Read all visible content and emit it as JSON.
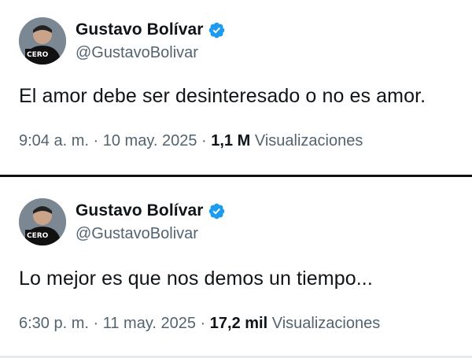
{
  "tweets": [
    {
      "author": {
        "name": "Gustavo Bolívar",
        "handle": "@GustavoBolivar",
        "avatar_badge": "CERO"
      },
      "text": "El amor debe ser desinteresado o no es amor.",
      "time": "9:04 a. m.",
      "separator": "·",
      "date": "10 may. 2025",
      "views_count": "1,1 M",
      "views_label": "Visualizaciones"
    },
    {
      "author": {
        "name": "Gustavo Bolívar",
        "handle": "@GustavoBolivar",
        "avatar_badge": "CERO"
      },
      "text": "Lo mejor es que nos demos un tiempo...",
      "time": "6:30 p. m.",
      "separator": "·",
      "date": "11 may. 2025",
      "views_count": "17,2 mil",
      "views_label": "Visualizaciones"
    }
  ],
  "colors": {
    "verified_blue": "#1d9bf0",
    "secondary_text": "#536471",
    "primary_text": "#0f1419"
  },
  "icons": {
    "verified": "verified-badge-icon"
  }
}
